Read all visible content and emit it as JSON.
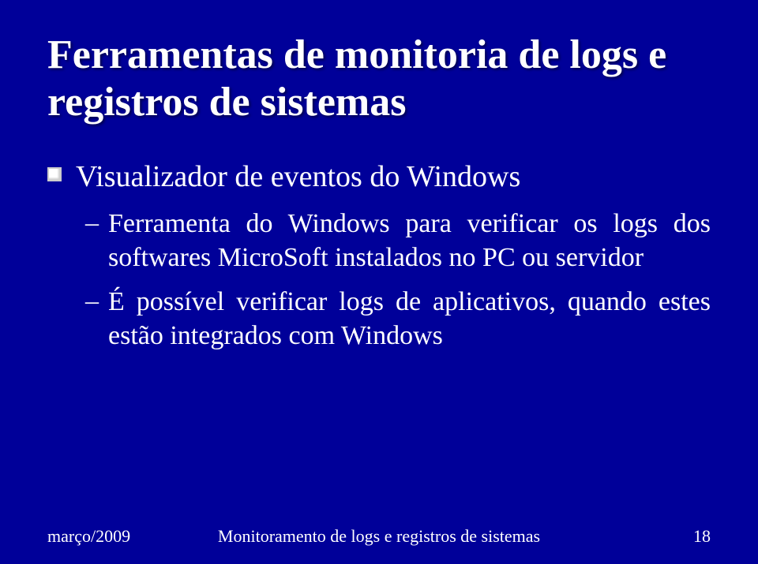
{
  "slide": {
    "title": "Ferramentas de monitoria de logs e registros de sistemas",
    "bullet1": "Visualizador de eventos do Windows",
    "sub1": "Ferramenta do Windows para verificar os logs dos softwares MicroSoft instalados no PC ou servidor",
    "sub2": "É possível verificar logs de aplicativos, quando estes estão integrados com Windows"
  },
  "footer": {
    "date": "março/2009",
    "title": "Monitoramento de logs e registros de sistemas",
    "page": "18"
  }
}
